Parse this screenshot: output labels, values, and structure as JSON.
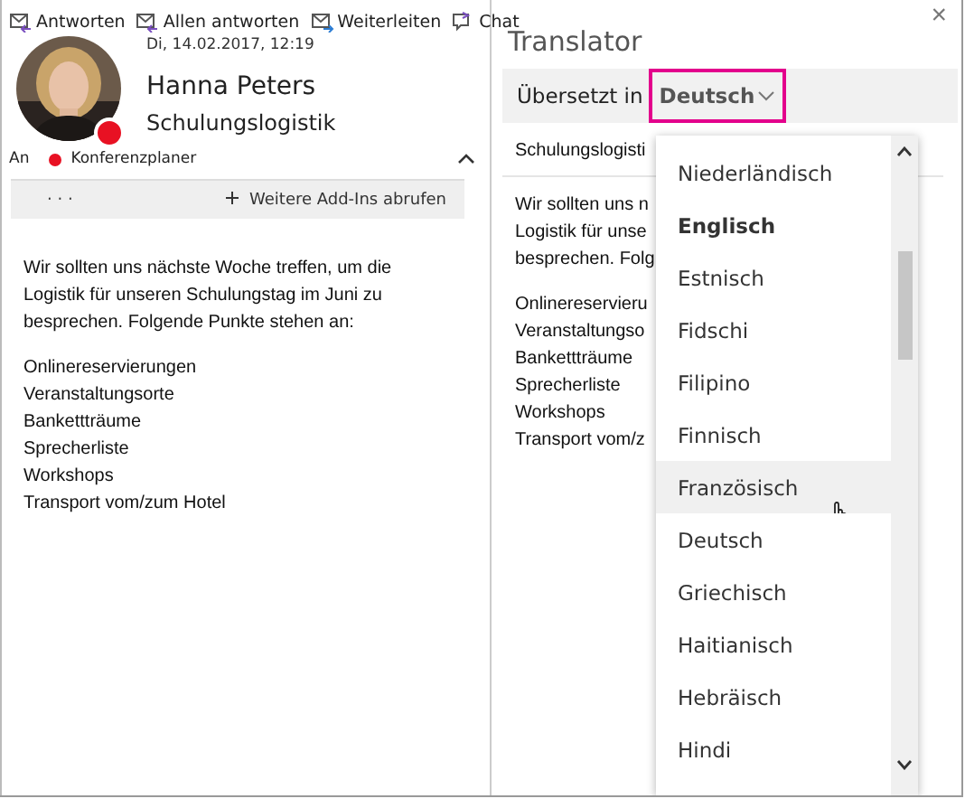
{
  "toolbar": [
    {
      "label": "Antworten",
      "kind": "reply"
    },
    {
      "label": "Allen antworten",
      "kind": "reply-all"
    },
    {
      "label": "Weiterleiten",
      "kind": "forward"
    },
    {
      "label": "Chat",
      "kind": "chat"
    }
  ],
  "message": {
    "date": "Di, 14.02.2017, 12:19",
    "sender": "Hanna Peters",
    "subject": "Schulungslogistik",
    "busy": true,
    "to_label": "An",
    "recipient": "Konferenzplaner",
    "recipient_busy": true,
    "more_label": "· · ·",
    "addins_label": "Weitere Add-Ins abrufen",
    "body": [
      "Wir sollten uns nächste Woche treffen, um die Logistik für unseren Schulungstag im Juni zu besprechen. Folgende Punkte stehen an:"
    ],
    "list": [
      "Onlinereservierungen",
      "Veranstaltungsorte",
      "Bankettträume",
      "Sprecherliste",
      "Workshops",
      "Transport vom/zum Hotel"
    ]
  },
  "translator": {
    "title": "Translator",
    "close": "×",
    "translate_label": "Übersetzt in",
    "language": "Deutsch",
    "subject": "Schulungslogisti",
    "body_lines": [
      "Wir sollten uns n",
      "Logistik für unse",
      "besprechen. Folg"
    ],
    "list": [
      "Onlinereservieru",
      "Veranstaltungso",
      "Bankettträume",
      "Sprecherliste",
      "Workshops",
      "Transport vom/z"
    ]
  },
  "dropdown": {
    "items": [
      {
        "label": "Niederländisch",
        "selected": false,
        "hovered": false
      },
      {
        "label": "Englisch",
        "selected": true,
        "hovered": false
      },
      {
        "label": "Estnisch",
        "selected": false,
        "hovered": false
      },
      {
        "label": "Fidschi",
        "selected": false,
        "hovered": false
      },
      {
        "label": "Filipino",
        "selected": false,
        "hovered": false
      },
      {
        "label": "Finnisch",
        "selected": false,
        "hovered": false
      },
      {
        "label": "Französisch",
        "selected": false,
        "hovered": true
      },
      {
        "label": "Deutsch",
        "selected": false,
        "hovered": false
      },
      {
        "label": "Griechisch",
        "selected": false,
        "hovered": false
      },
      {
        "label": "Haitianisch",
        "selected": false,
        "hovered": false
      },
      {
        "label": "Hebräisch",
        "selected": false,
        "hovered": false
      },
      {
        "label": "Hindi",
        "selected": false,
        "hovered": false
      }
    ]
  }
}
